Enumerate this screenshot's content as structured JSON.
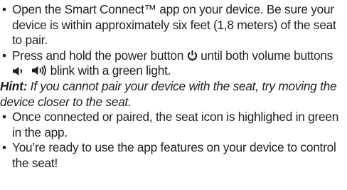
{
  "bullet_glyph": "•",
  "steps": {
    "step1": "Open the Smart Connect™ app on your device. Be sure your device is within approximately six feet (1,8 meters) of the seat to pair.",
    "step2_before_power": "Press and hold the power button ",
    "step2_between": " until both volume buttons ",
    "step2_after": " blink with a green light.",
    "step3": "Once connected or paired, the seat icon is highlighed in green in the app.",
    "step4": "You’re ready to use the app features on your device to control the seat!"
  },
  "hint": {
    "label": "Hint:",
    "text": " If you cannot pair your device with the seat, try moving the device closer to the seat."
  },
  "icons": {
    "power": "power-icon",
    "volume_down": "volume-down-icon",
    "volume_up": "volume-up-icon"
  },
  "colors": {
    "text": "#231f20"
  }
}
